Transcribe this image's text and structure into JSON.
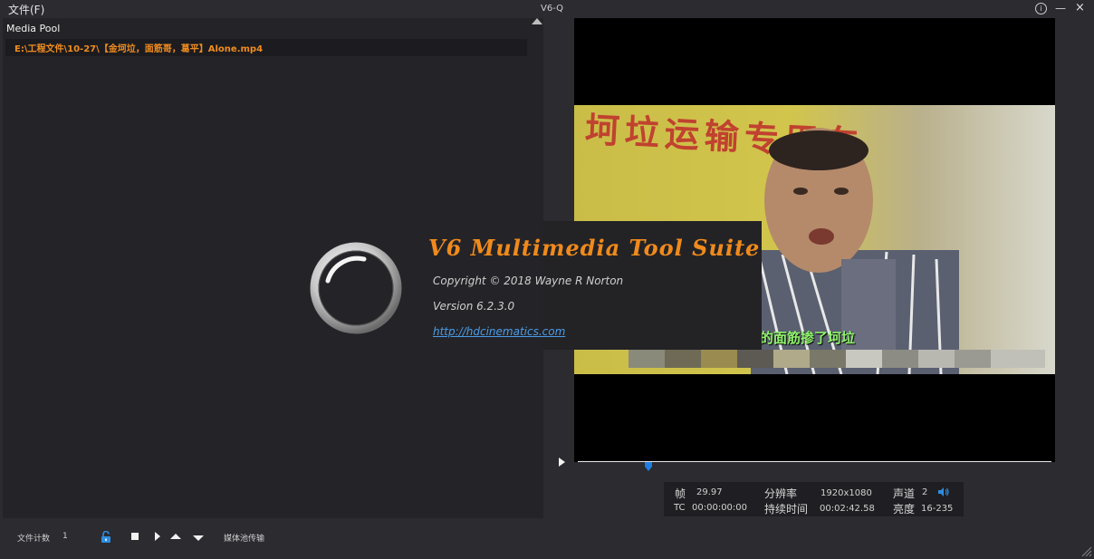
{
  "window": {
    "file_menu": "文件(F)",
    "title": "V6-Q",
    "info_icon": "info-icon",
    "minimize_glyph": "—",
    "close_glyph": "×"
  },
  "media_pool": {
    "title": "Media Pool",
    "items": [
      {
        "path": "E:\\工程文件\\10-27\\【金坷垃，面筋哥，葛平】Alone.mp4"
      }
    ]
  },
  "toolbar": {
    "file_count_label": "文件计数",
    "file_count_value": "1",
    "transfer_label": "媒体池传输"
  },
  "video": {
    "subtitle": "是的面筋掺了坷垃",
    "banner": "坷垃运输专用车",
    "progress": 0.15
  },
  "info": {
    "frame_label": "帧",
    "frame_rate": "29.97",
    "tc_label": "TC",
    "tc_value": "00:00:00:00",
    "resolution_label": "分辨率",
    "resolution_value": "1920x1080",
    "duration_label": "持续时间",
    "duration_value": "00:02:42.58",
    "channels_label": "声道",
    "channels_value": "2",
    "brightness_label": "亮度",
    "brightness_value": "16-235"
  },
  "splash": {
    "title": "V6 Multimedia Tool Suite",
    "copyright": "Copyright ©  2018 Wayne R Norton",
    "version": "Version 6.2.3.0",
    "website": "http://hdcinematics.com"
  },
  "colors": {
    "accent_orange": "#f08c1e",
    "link_blue": "#4a9ce8",
    "playhead_blue": "#1e7fe0",
    "subtitle_green": "#8ef06a"
  }
}
